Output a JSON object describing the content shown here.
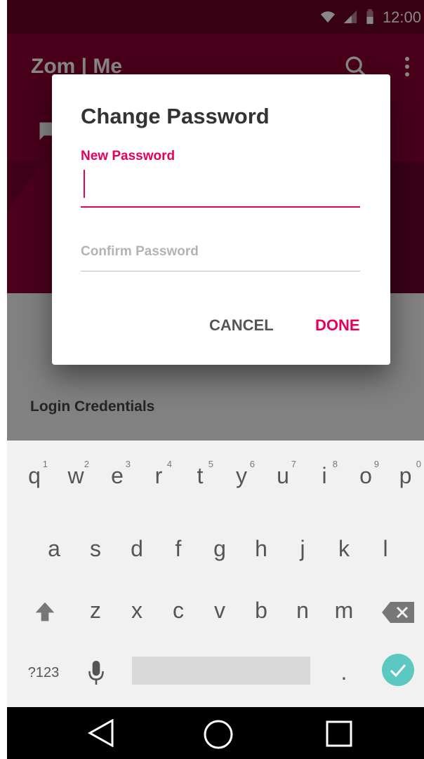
{
  "status_bar": {
    "time": "12:00"
  },
  "app_bar": {
    "title": "Zom | Me"
  },
  "content": {
    "section_title": "Login Credentials"
  },
  "dialog": {
    "title": "Change Password",
    "new_password_label": "New Password",
    "new_password_value": "",
    "confirm_password_placeholder": "Confirm Password",
    "cancel_label": "CANCEL",
    "done_label": "DONE"
  },
  "keyboard": {
    "row1": [
      {
        "key": "q",
        "hint": "1"
      },
      {
        "key": "w",
        "hint": "2"
      },
      {
        "key": "e",
        "hint": "3"
      },
      {
        "key": "r",
        "hint": "4"
      },
      {
        "key": "t",
        "hint": "5"
      },
      {
        "key": "y",
        "hint": "6"
      },
      {
        "key": "u",
        "hint": "7"
      },
      {
        "key": "i",
        "hint": "8"
      },
      {
        "key": "o",
        "hint": "9"
      },
      {
        "key": "p",
        "hint": "0"
      }
    ],
    "row2": [
      "a",
      "s",
      "d",
      "f",
      "g",
      "h",
      "j",
      "k",
      "l"
    ],
    "row3": [
      "z",
      "x",
      "c",
      "v",
      "b",
      "n",
      "m"
    ],
    "symbols_label": "?123",
    "period_label": "."
  },
  "colors": {
    "accent": "#e6005c",
    "status_bar": "#6b0024",
    "app_bar": "#8a0033",
    "keyboard_bg": "#f1f1f1",
    "check_button": "#5bc9c1"
  }
}
